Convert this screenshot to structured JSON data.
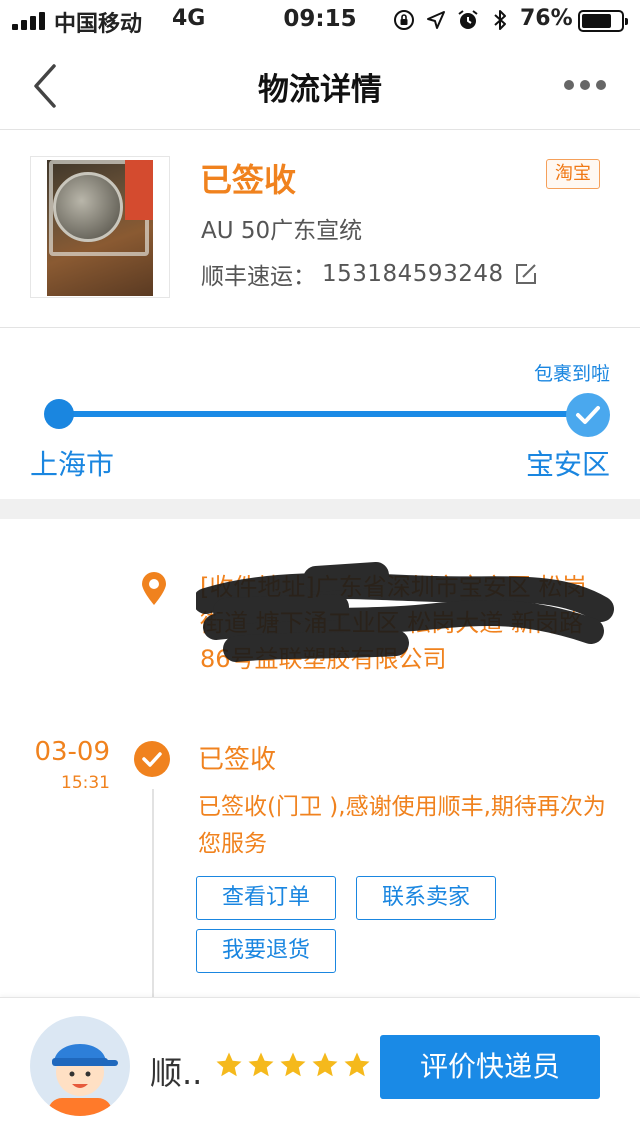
{
  "status_bar": {
    "carrier": "中国移动",
    "network": "4G",
    "time": "09:15",
    "battery_percent": "76%",
    "battery_level": 0.76,
    "icons": [
      "rotation-lock-icon",
      "location-arrow-icon",
      "alarm-icon",
      "bluetooth-icon"
    ]
  },
  "nav": {
    "title": "物流详情"
  },
  "package": {
    "status": "已签收",
    "source_tag": "淘宝",
    "product_name": "AU 50广东宣统",
    "courier_label": "顺丰速运：",
    "tracking_number": "153184593248"
  },
  "progress": {
    "arrived_label": "包裹到啦",
    "origin": "上海市",
    "destination": "宝安区"
  },
  "timeline": {
    "address": "[收件地址]广东省深圳市宝安区 松岗街道 塘下涌工业区 松岗大道 新岗路86号益联塑胶有限公司",
    "event": {
      "date": "03-09",
      "time": "15:31",
      "title": "已签收",
      "description": "已签收(门卫 ),感谢使用顺丰,期待再次为您服务"
    },
    "buttons": {
      "view_order": "查看订单",
      "contact_seller": "联系卖家",
      "return_goods": "我要退货"
    }
  },
  "bottom": {
    "courier_name": "顺..",
    "rating_stars": 5,
    "rate_button": "评价快递员"
  },
  "colors": {
    "accent_orange": "#f0821e",
    "accent_blue": "#1a86e0",
    "star_yellow": "#f5b91c"
  }
}
